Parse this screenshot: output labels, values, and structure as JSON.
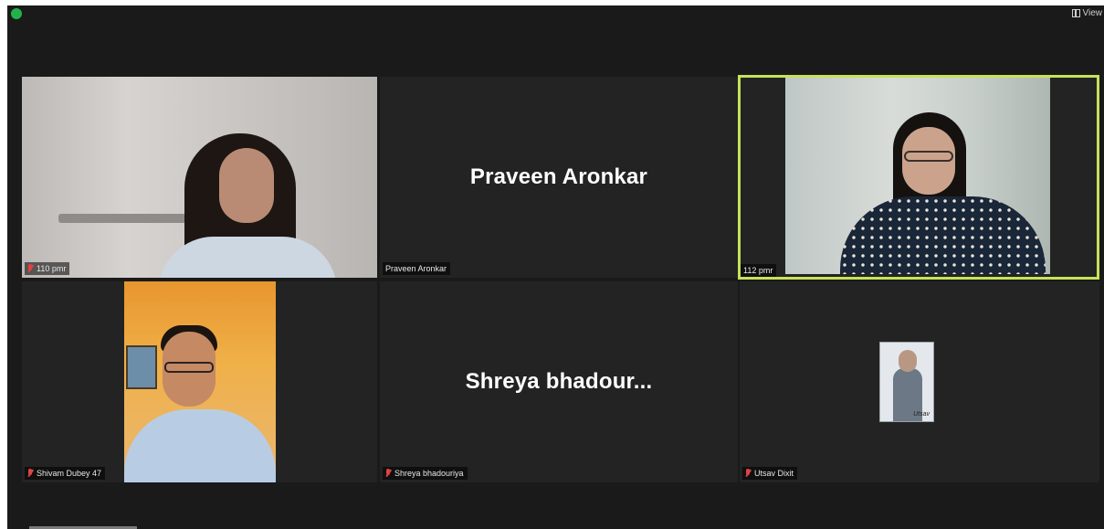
{
  "toolbar": {
    "view_label": "View"
  },
  "participants": [
    {
      "name": "110 pmr",
      "muted": true,
      "video": true
    },
    {
      "name": "Praveen Aronkar",
      "display_name": "Praveen Aronkar",
      "muted": false,
      "video": false
    },
    {
      "name": "112 pmr",
      "muted": false,
      "video": true,
      "active_speaker": true
    },
    {
      "name": "Shivam Dubey 47",
      "muted": true,
      "video": true
    },
    {
      "name": "Shreya bhadouriya",
      "display_name": "Shreya  bhadour...",
      "muted": true,
      "video": false
    },
    {
      "name": "Utsav Dixit",
      "muted": true,
      "video": false,
      "avatar": true
    }
  ],
  "colors": {
    "active_border": "#c6e25a",
    "muted_icon": "#e04343",
    "background": "#1a1a1a",
    "tile": "#232323"
  }
}
